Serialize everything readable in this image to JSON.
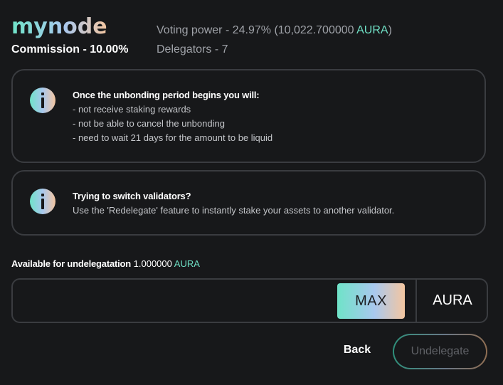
{
  "validator": {
    "name": "mynode",
    "commission": "Commission - 10.00%",
    "voting_power_prefix": "Voting power - 24.97% (10,022.700000 ",
    "voting_power_denom": "AURA",
    "voting_power_suffix": ")",
    "delegators": "Delegators - 7"
  },
  "notices": {
    "unbonding": {
      "title": "Once the unbonding period begins you will:",
      "lines": [
        "- not receive staking rewards",
        "- not be able to cancel the unbonding",
        "- need to wait 21 days for the amount to be liquid"
      ]
    },
    "redelegate": {
      "title": "Trying to switch validators?",
      "body": "Use the 'Redelegate' feature to instantly stake your assets to another validator."
    }
  },
  "available": {
    "label": "Available for undelegatation",
    "amount": "1.000000",
    "denom": "AURA"
  },
  "amount_input": {
    "value": "",
    "placeholder": "",
    "max_label": "MAX",
    "unit": "AURA"
  },
  "actions": {
    "back_label": "Back",
    "undelegate_label": "Undelegate"
  },
  "colors": {
    "background": "#17181a",
    "accent": "#6fe0c5",
    "muted_text": "#9fa2a8",
    "border": "#3a3c40",
    "disabled_text": "#5f6166"
  },
  "icons": {
    "notice_icon": "info-icon"
  }
}
